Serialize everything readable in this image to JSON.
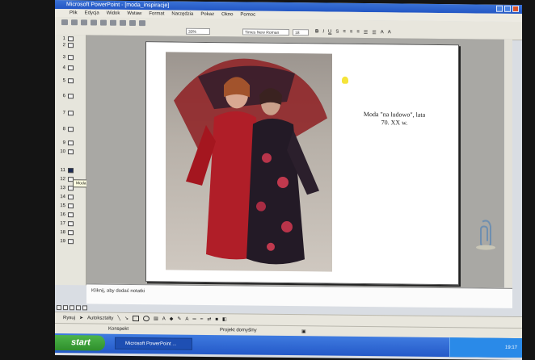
{
  "window": {
    "title": "Microsoft PowerPoint - [moda_inspiracje]"
  },
  "menu": [
    "Plik",
    "Edycja",
    "Widok",
    "Wstaw",
    "Format",
    "Narzędzia",
    "Pokaz",
    "Okno",
    "Pomoc"
  ],
  "toolbar": {
    "zoom": "33%",
    "font_name": "Times New Roman",
    "font_size": "18"
  },
  "outline": {
    "slide_numbers": [
      "1",
      "2",
      "3",
      "4",
      "5",
      "6",
      "7",
      "8",
      "9",
      "10",
      "11",
      "12",
      "13",
      "14",
      "15",
      "16",
      "17",
      "18",
      "19"
    ],
    "active_slide": "11",
    "tooltip": "Moda \"na ludowo\", lata 70. XX w."
  },
  "slide": {
    "caption_line1": "Moda \"na ludowo\", lata",
    "caption_line2": "70. XX w."
  },
  "notes": {
    "placeholder": "Kliknij, aby dodać notatki"
  },
  "drawbar": {
    "draw_label": "Rysuj",
    "autoshapes_label": "Autokształty"
  },
  "statusbar": {
    "left": "Konspekt",
    "center": "Projekt domyślny"
  },
  "taskbar": {
    "start": "start",
    "task": "Microsoft PowerPoint ...",
    "clock": "19:17"
  },
  "colors": {
    "titlebar": "#2356c4",
    "taskbar": "#2459c8",
    "start_button": "#2f8f2c"
  }
}
